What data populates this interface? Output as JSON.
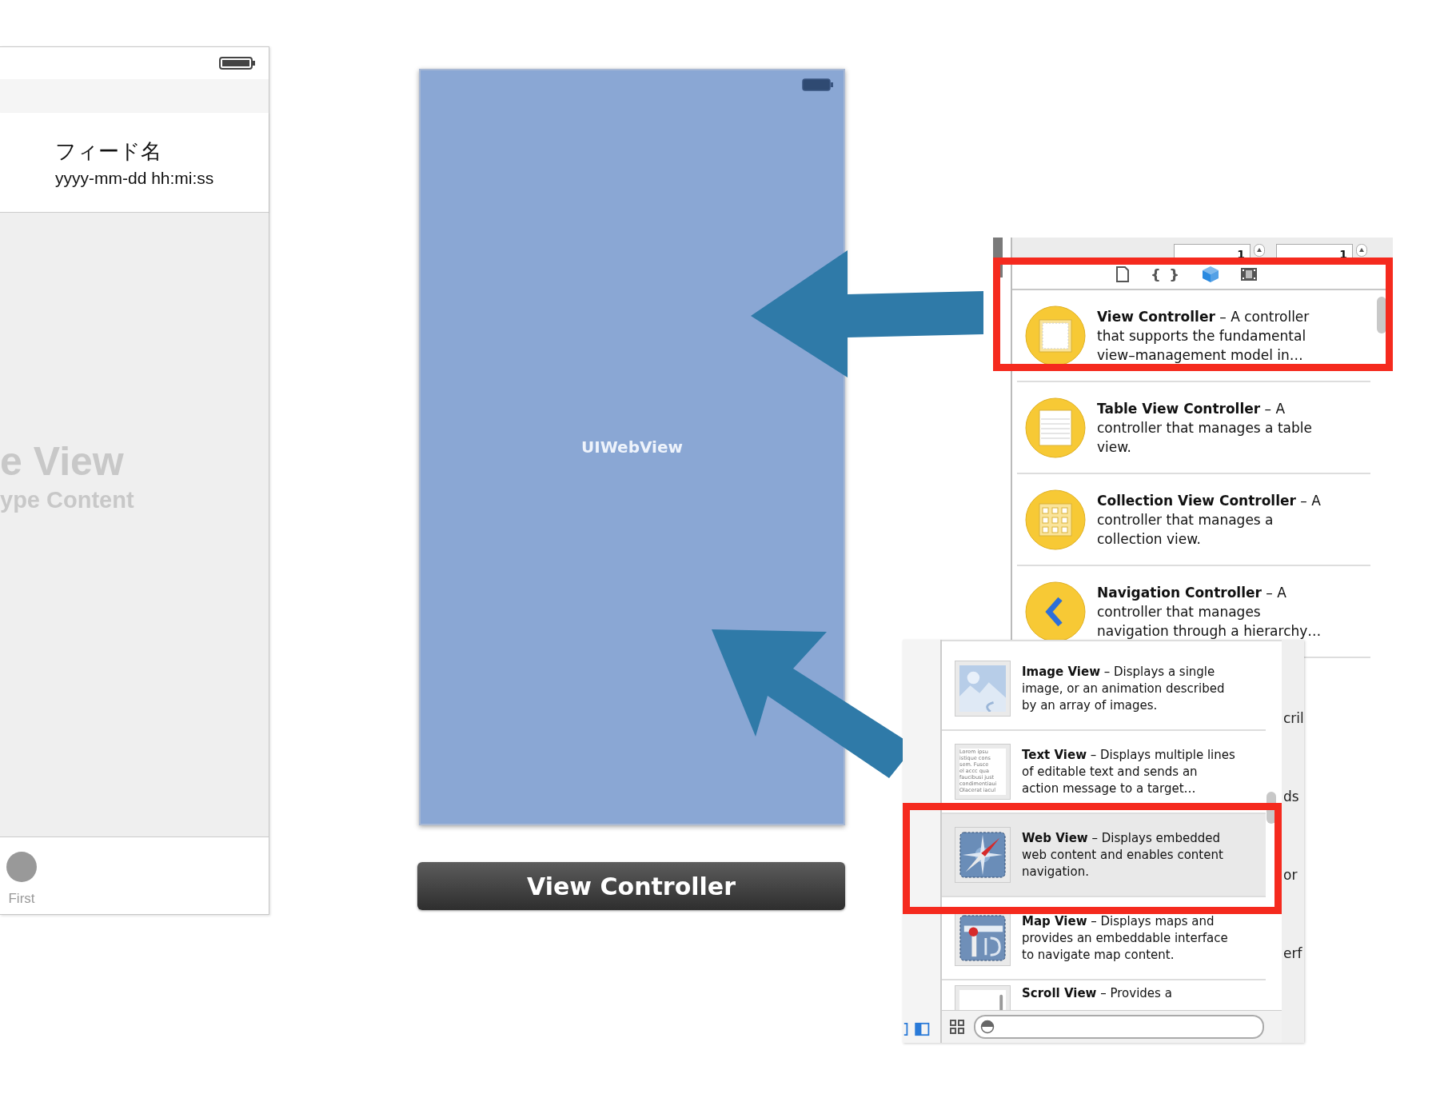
{
  "feed_scene": {
    "cell_title": "フィード名",
    "cell_subtitle": "yyyy-mm-dd hh:mi:ss",
    "placeholder_title": "e View",
    "placeholder_subtitle": "ype Content",
    "tab_label": "First"
  },
  "web_scene": {
    "view_label": "UIWebView",
    "scene_label": "View Controller"
  },
  "library_top": {
    "steppers": [
      {
        "value": "1"
      },
      {
        "value": "1"
      }
    ],
    "tabs": [
      {
        "kind": "file",
        "selected": false
      },
      {
        "kind": "code",
        "glyph": "{ }",
        "selected": false
      },
      {
        "kind": "objects",
        "selected": true
      },
      {
        "kind": "media",
        "selected": false
      }
    ],
    "items": [
      {
        "kind": "view-controller",
        "text": "**View Controller** – A controller that supports the fundamental view–management model in…",
        "highlighted": true
      },
      {
        "kind": "table",
        "text": "**Table View Controller** – A controller that manages a table view.",
        "highlighted": false
      },
      {
        "kind": "collection",
        "text": "**Collection View Controller** – A controller that manages a collection view.",
        "highlighted": false
      },
      {
        "kind": "navigation",
        "text": "**Navigation Controller** – A controller that manages navigation through a hierarchy…",
        "highlighted": false
      }
    ]
  },
  "library_bottom": {
    "items": [
      {
        "kind": "image",
        "text": "**Image View** – Displays a single image, or an animation described by an array of images.",
        "selected": false,
        "highlighted": false
      },
      {
        "kind": "text",
        "text": "**Text View** – Displays multiple lines of editable text and sends an action message to a target…",
        "selected": false,
        "highlighted": false,
        "sample_lines": [
          "Lorem ipsu",
          "istique cons",
          "sem. Fusce",
          "el  accc  qua",
          "faucibusi  just",
          "condimentiaui",
          "Olacerat  iacul"
        ]
      },
      {
        "kind": "web",
        "text": "**Web View** – Displays embedded web content and enables content navigation.",
        "selected": true,
        "highlighted": true
      },
      {
        "kind": "map",
        "text": "**Map View** – Displays maps and provides an embeddable interface to navigate map content.",
        "selected": false,
        "highlighted": false
      },
      {
        "kind": "scroll",
        "text": "**Scroll View** – Provides a",
        "selected": false,
        "highlighted": false
      }
    ]
  },
  "background_fragments": [
    "cril",
    "ds",
    "or",
    "erf"
  ]
}
